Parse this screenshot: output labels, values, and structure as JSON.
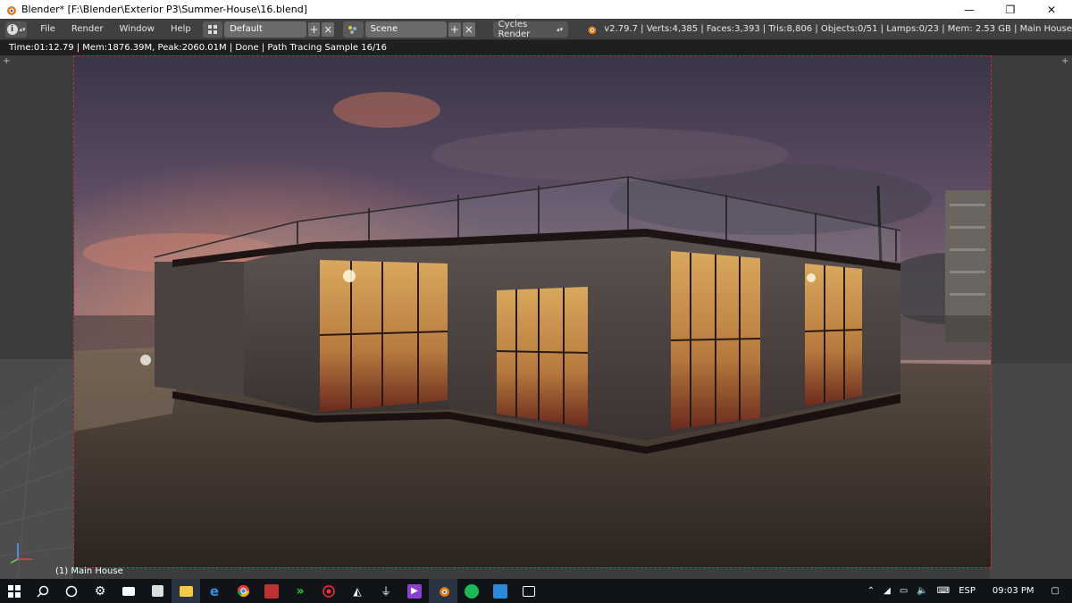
{
  "window": {
    "title": "Blender* [F:\\Blender\\Exterior P3\\Summer-House\\16.blend]",
    "minimize_glyph": "—",
    "maximize_glyph": "❐",
    "close_glyph": "✕"
  },
  "header": {
    "info_icon": "i",
    "menus": [
      "File",
      "Render",
      "Window",
      "Help"
    ],
    "screen_layout": "Default",
    "scene": "Scene",
    "render_engine": "Cycles Render",
    "stats": "v2.79.7 | Verts:4,385 | Faces:3,393 | Tris:8,806 | Objects:0/51 | Lamps:0/23 | Mem: 2.53 GB | Main House",
    "add_glyph": "+",
    "remove_glyph": "×"
  },
  "render_info": "Time:01:12.79 | Mem:1876.39M, Peak:2060.01M | Done | Path Tracing Sample 16/16",
  "viewport": {
    "object_label": "(1) Main House"
  },
  "taskbar": {
    "language": "ESP",
    "time": "09:03 PM",
    "icons": [
      "windows-start-icon",
      "search-icon",
      "cortana-icon",
      "settings-icon",
      "mail-icon",
      "store-icon",
      "file-explorer-icon",
      "edge-icon",
      "chrome-icon",
      "media-icon",
      "arrow-app-icon",
      "record-icon",
      "inkscape-icon",
      "plug-icon",
      "visual-studio-icon",
      "blender-icon",
      "spotify-icon",
      "camera-app-icon",
      "photos-icon"
    ]
  }
}
